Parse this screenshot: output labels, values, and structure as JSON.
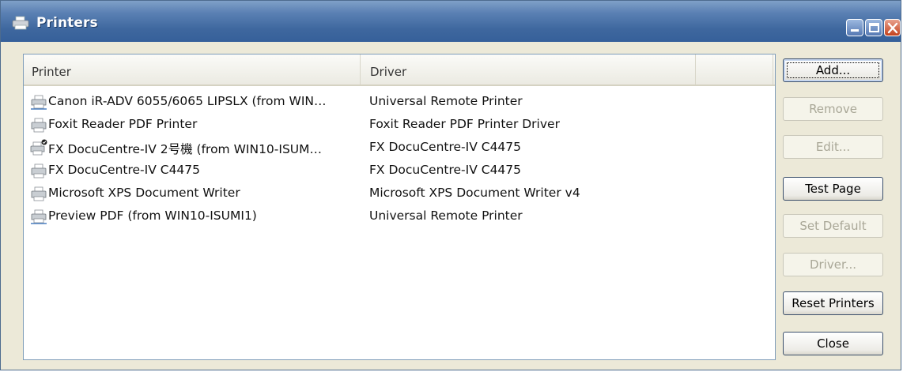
{
  "window": {
    "title": "Printers",
    "app_icon": "printer-icon",
    "controls": [
      "minimize-icon",
      "maximize-icon",
      "close-icon"
    ],
    "colors": {
      "titlebar": "#3e679e",
      "close": "#c4421d",
      "face": "#ece9d8"
    }
  },
  "list": {
    "columns": {
      "printer": "Printer",
      "driver": "Driver"
    },
    "rows": [
      {
        "name": "Canon iR-ADV 6055/6065 LIPSLX (from WIN…",
        "driver": "Universal Remote Printer",
        "icon": "network-printer-icon"
      },
      {
        "name": "Foxit Reader PDF Printer",
        "driver": "Foxit Reader PDF Printer Driver",
        "icon": "printer-icon"
      },
      {
        "name": "FX DocuCentre-IV 2号機 (from WIN10-ISUM…",
        "driver": "FX DocuCentre-IV C4475",
        "icon": "default-printer-icon"
      },
      {
        "name": "FX DocuCentre-IV C4475",
        "driver": "FX DocuCentre-IV C4475",
        "icon": "printer-icon"
      },
      {
        "name": "Microsoft XPS Document Writer",
        "driver": "Microsoft XPS Document Writer v4",
        "icon": "printer-icon"
      },
      {
        "name": "Preview PDF (from WIN10-ISUMI1)",
        "driver": "Universal Remote Printer",
        "icon": "network-printer-icon"
      }
    ]
  },
  "buttons": {
    "add": "Add...",
    "remove": "Remove",
    "edit": "Edit...",
    "test_page": "Test Page",
    "set_default": "Set Default",
    "driver": "Driver...",
    "reset_printers": "Reset Printers",
    "close": "Close"
  }
}
